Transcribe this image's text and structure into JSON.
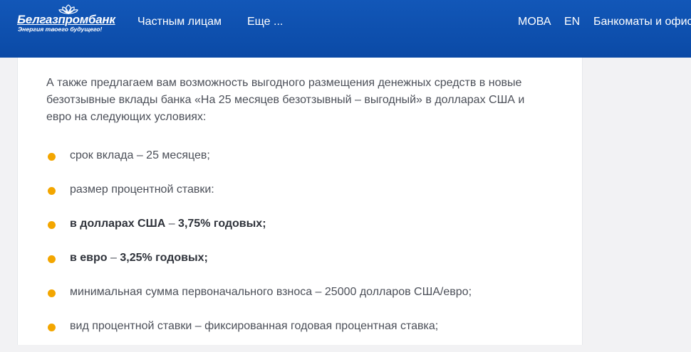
{
  "header": {
    "logo": {
      "name": "Белгазпромбанк",
      "tagline": "Энергия твоего будущего!"
    },
    "nav_left": [
      "Частным лицам",
      "Еще ..."
    ],
    "nav_right": [
      "МОВА",
      "EN",
      "Банкоматы и офисы"
    ]
  },
  "content": {
    "intro": "А также предлагаем вам возможность выгодного размещения денежных средств в новые безотзывные вклады банка «На 25 месяцев безотзывный – выгодный» в долларах США и евро на следующих условиях:",
    "items": [
      {
        "text": "срок вклада – 25 месяцев;"
      },
      {
        "text": "размер процентной ставки:"
      },
      {
        "bold": "в долларах США",
        "text": " – ",
        "bold2": "3,75% годовых;"
      },
      {
        "bold": "в евро",
        "text": " – ",
        "bold2": "3,25% годовых;"
      },
      {
        "text": "минимальная сумма первоначального взноса – 25000 долларов США/евро;"
      },
      {
        "text": "вид процентной ставки – фиксированная годовая процентная ставка;"
      }
    ]
  },
  "colors": {
    "header_blue": "#0b4aa6",
    "bullet_orange": "#f3a600",
    "text_gray": "#4b4f58"
  }
}
